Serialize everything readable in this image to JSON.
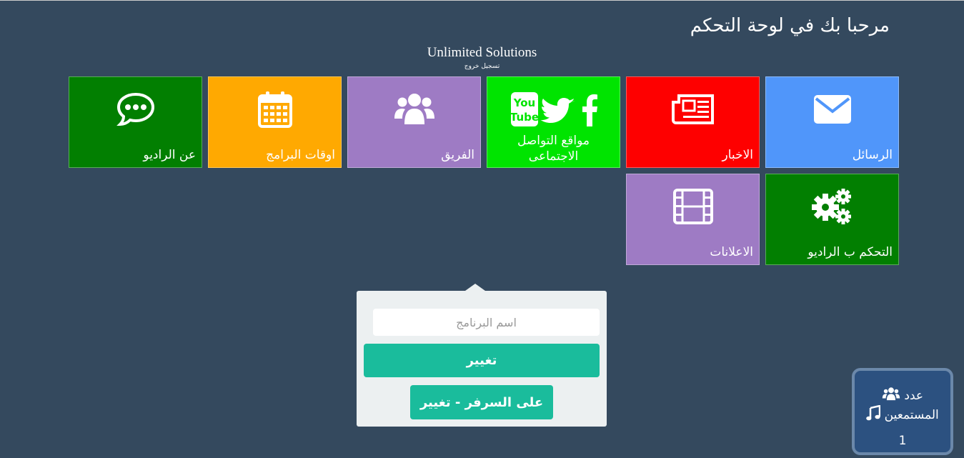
{
  "header": {
    "welcome": "مرحبا بك في لوحة التحكم",
    "brand": "Unlimited Solutions",
    "logout": "تسجيل خروج"
  },
  "tiles": [
    {
      "label": "الرسائل",
      "color": "#5096fa",
      "icon": "envelope-icon"
    },
    {
      "label": "الاخبار",
      "color": "#fe0000",
      "icon": "newspaper-icon"
    },
    {
      "label": "مواقع التواصل الاجتماعى",
      "color": "#00e400",
      "icon": "social-media-icon"
    },
    {
      "label": "الفريق",
      "color": "#9e7bc4",
      "icon": "users-icon"
    },
    {
      "label": "اوقات البرامج",
      "color": "#ffa901",
      "icon": "calendar-icon"
    },
    {
      "label": "عن الراديو",
      "color": "#027f01",
      "icon": "comment-dots-icon"
    },
    {
      "label": "التحكم ب الراديو",
      "color": "#027f01",
      "icon": "gears-icon"
    },
    {
      "label": "الاعلانات",
      "color": "#9e7bc4",
      "icon": "film-icon"
    }
  ],
  "popover": {
    "placeholder": "اسم البرنامج",
    "change_label": "تغيير",
    "server_change_label": "على السرفر - تغيير"
  },
  "listeners": {
    "line1": "عدد",
    "line2": "المستمعين",
    "count": "1"
  },
  "colors": {
    "background": "#34495e",
    "accent": "#1abc9c",
    "popover_bg": "#ecf0f1",
    "listeners_bg": "#2c5180"
  }
}
